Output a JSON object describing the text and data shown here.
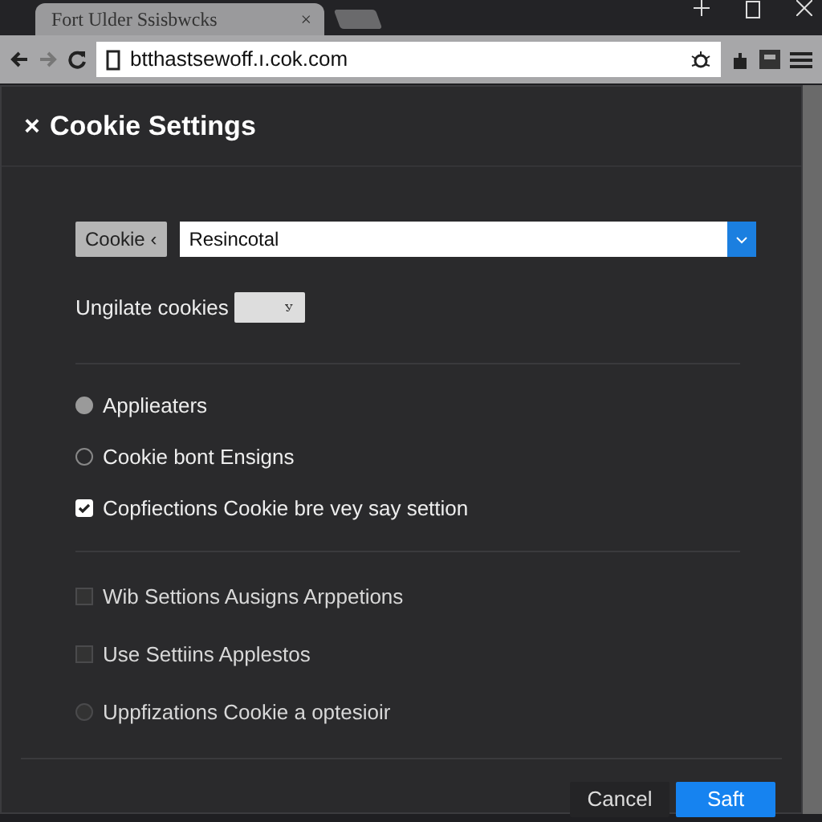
{
  "browser": {
    "tab": {
      "title": "Fort Ulder Ssisbwcks",
      "close": "×"
    },
    "url": "btthastsewoff.ı.cok.com"
  },
  "dialog": {
    "title": "Cookie Settings",
    "close": "×",
    "filter": {
      "button": "Cookie ‹",
      "value": "Resincotal"
    },
    "update": {
      "label": "Ungilate cookies",
      "select": "ꭹ"
    },
    "groups": [
      [
        {
          "kind": "radio",
          "label": "Applieaters",
          "checked": true,
          "disabled": false
        },
        {
          "kind": "radio",
          "label": "Cookie bont  Ensigns",
          "checked": false,
          "disabled": false
        },
        {
          "kind": "checkbox",
          "label": "Copfiections  Cookie bre vey say settion",
          "checked": true,
          "disabled": false
        }
      ],
      [
        {
          "kind": "checkbox",
          "label": "Wib Settions  Ausigns Arppetions",
          "checked": false,
          "disabled": true
        },
        {
          "kind": "checkbox",
          "label": "Use Settiins  Applestos",
          "checked": false,
          "disabled": true
        },
        {
          "kind": "radio",
          "label": "Uppfizations Cookie a optesioir",
          "checked": false,
          "disabled": true
        }
      ]
    ],
    "buttons": [
      {
        "label": "Cancel",
        "primary": false
      },
      {
        "label": "Saft",
        "primary": true
      }
    ]
  }
}
